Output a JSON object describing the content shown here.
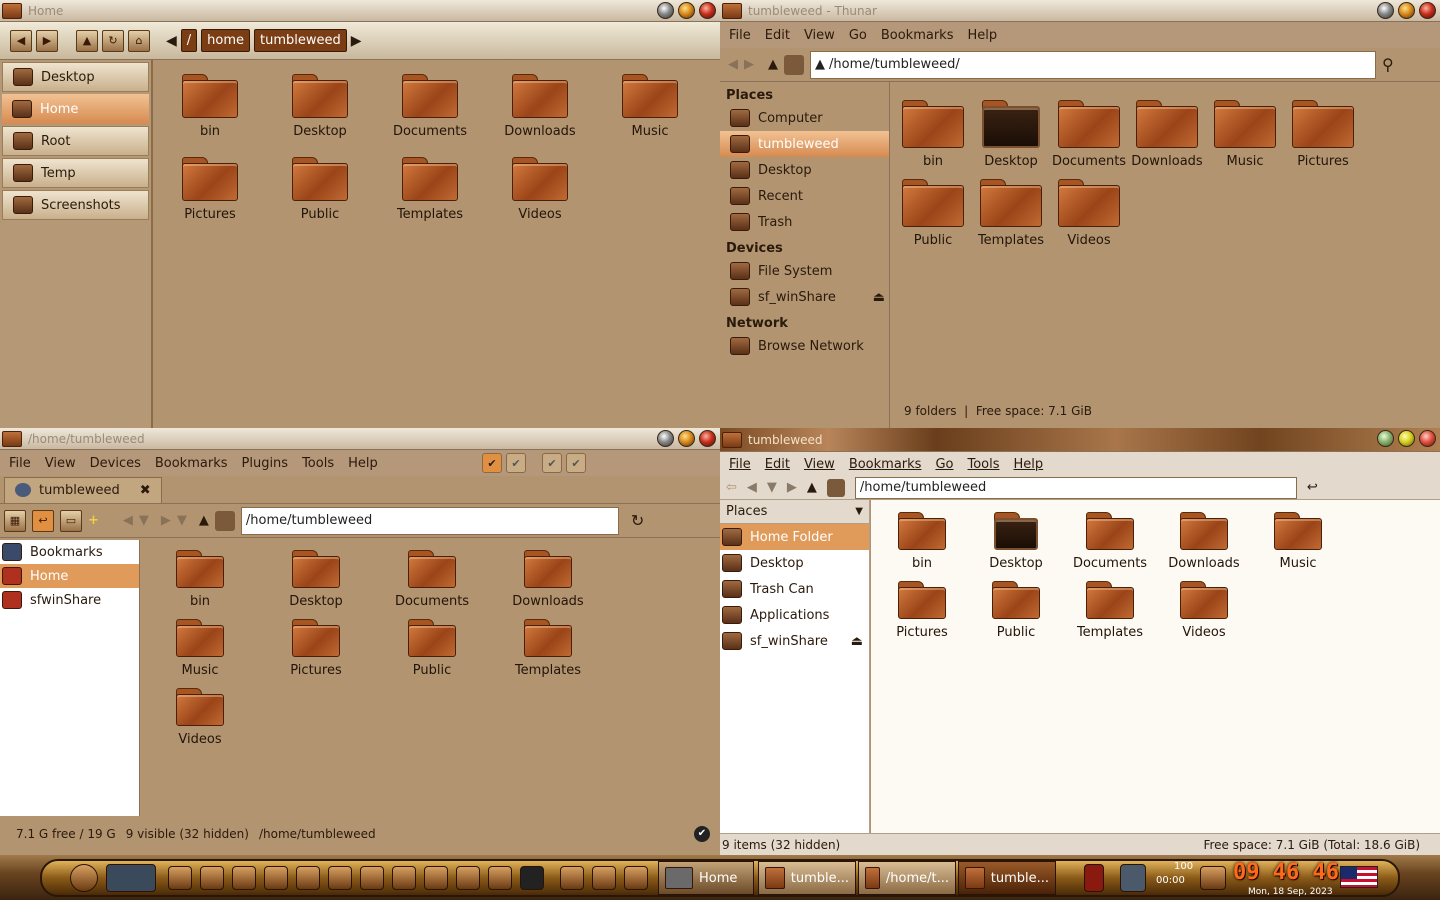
{
  "colors": {
    "accent": "#e09a5a",
    "panel": "#b29470",
    "folder": "#b85f2a"
  },
  "win1": {
    "title": "Home",
    "crumbs": [
      "/",
      "home",
      "tumbleweed"
    ],
    "side": [
      {
        "label": "Desktop",
        "icon": "desktop-icon"
      },
      {
        "label": "Home",
        "icon": "home-icon"
      },
      {
        "label": "Root",
        "icon": "root-icon"
      },
      {
        "label": "Temp",
        "icon": "temp-icon"
      },
      {
        "label": "Screenshots",
        "icon": "screenshots-icon"
      }
    ],
    "items": [
      "bin",
      "Desktop",
      "Documents",
      "Downloads",
      "Music",
      "Pictures",
      "Public",
      "Templates",
      "Videos"
    ]
  },
  "win2": {
    "title": "tumbleweed - Thunar",
    "menu": [
      "File",
      "Edit",
      "View",
      "Go",
      "Bookmarks",
      "Help"
    ],
    "path": "/home/tumbleweed/",
    "places_head": "Places",
    "places": [
      "Computer",
      "tumbleweed",
      "Desktop",
      "Recent",
      "Trash"
    ],
    "devices_head": "Devices",
    "devices": [
      "File System",
      "sf_winShare"
    ],
    "network_head": "Network",
    "network": [
      "Browse Network"
    ],
    "items": [
      "bin",
      "Desktop",
      "Documents",
      "Downloads",
      "Music",
      "Pictures",
      "Public",
      "Templates",
      "Videos"
    ],
    "status": "9 folders  |  Free space: 7.1 GiB"
  },
  "win3": {
    "title": "/home/tumbleweed",
    "menu": [
      "File",
      "View",
      "Devices",
      "Bookmarks",
      "Plugins",
      "Tools",
      "Help"
    ],
    "tab": "tumbleweed",
    "path": "/home/tumbleweed",
    "side": [
      "Bookmarks",
      "Home",
      "sfwinShare"
    ],
    "items": [
      "bin",
      "Desktop",
      "Documents",
      "Downloads",
      "Music",
      "Pictures",
      "Public",
      "Templates",
      "Videos"
    ],
    "status_free": "7.1 G free / 19 G",
    "status_visible": "9 visible (32 hidden)",
    "status_path": "/home/tumbleweed"
  },
  "win4": {
    "title": "tumbleweed",
    "menu": [
      "File",
      "Edit",
      "View",
      "Bookmarks",
      "Go",
      "Tools",
      "Help"
    ],
    "path": "/home/tumbleweed",
    "places_head": "Places",
    "places": [
      "Home Folder",
      "Desktop",
      "Trash Can",
      "Applications",
      "sf_winShare"
    ],
    "items": [
      "bin",
      "Desktop",
      "Documents",
      "Downloads",
      "Music",
      "Pictures",
      "Public",
      "Templates",
      "Videos"
    ],
    "status_left": "9 items (32 hidden)",
    "status_right": "Free space: 7.1 GiB (Total: 18.6 GiB)"
  },
  "taskbar": {
    "tasks": [
      "Home",
      "tumble...",
      "/home/t...",
      "tumble..."
    ],
    "battery": "100",
    "timer": "00:00",
    "clock": "09 46 46",
    "date": "Mon, 18 Sep, 2023"
  }
}
